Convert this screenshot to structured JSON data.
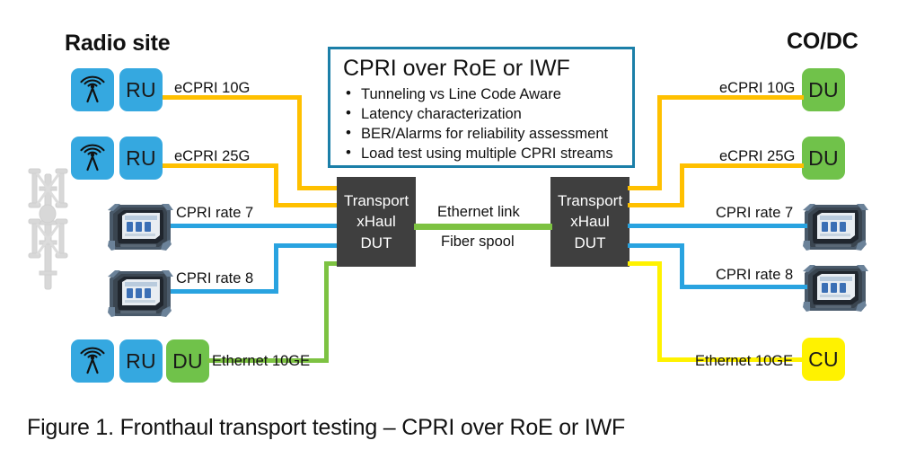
{
  "figure": {
    "caption": "Figure 1. Fronthaul transport testing – CPRI over RoE or IWF"
  },
  "headings": {
    "left": "Radio site",
    "right": "CO/DC"
  },
  "callout": {
    "title": "CPRI over RoE or IWF",
    "bullets": [
      "Tunneling vs Line Code Aware",
      "Latency characterization",
      "BER/Alarms for reliability assessment",
      "Load test using multiple CPRI streams"
    ]
  },
  "dut": {
    "left": {
      "line1": "Transport",
      "line2": "xHaul",
      "line3": "DUT"
    },
    "right": {
      "line1": "Transport",
      "line2": "xHaul",
      "line3": "DUT"
    }
  },
  "center_link": {
    "top_label": "Ethernet link",
    "bottom_label": "Fiber spool"
  },
  "nodes": {
    "left": [
      {
        "type": "ru",
        "label": "RU"
      },
      {
        "type": "ru",
        "label": "RU"
      },
      {
        "type": "ru",
        "label": "RU"
      },
      {
        "type": "du",
        "label": "DU"
      }
    ],
    "right": [
      {
        "type": "du",
        "label": "DU"
      },
      {
        "type": "du",
        "label": "DU"
      },
      {
        "type": "cu",
        "label": "CU"
      }
    ]
  },
  "link_labels": {
    "left": [
      "eCPRI 10G",
      "eCPRI 25G",
      "CPRI rate 7",
      "CPRI rate 8",
      "Ethernet 10GE"
    ],
    "right": [
      "eCPRI 10G",
      "eCPRI 25G",
      "CPRI rate 7",
      "CPRI rate 8",
      "Ethernet 10GE"
    ]
  },
  "colors": {
    "amber": "#ffc000",
    "blue": "#29a3e0",
    "green": "#7dc242",
    "yellow": "#fff200",
    "ru_blue": "#35a8e0",
    "du_green": "#70c24a",
    "cu_yellow": "#fff200",
    "dut_gray": "#3f3f3f",
    "callout_border": "#1b7fa8"
  },
  "icons": {
    "antenna": "antenna-icon",
    "tower": "cell-tower-icon",
    "tester": "handheld-tester-icon"
  }
}
